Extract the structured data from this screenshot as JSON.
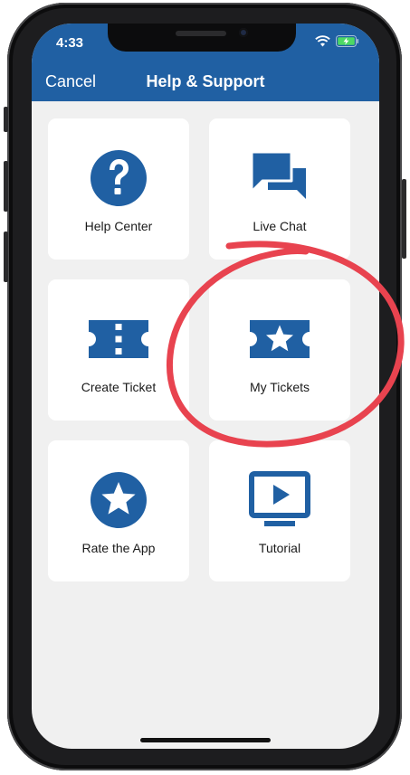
{
  "status_bar": {
    "time": "4:33"
  },
  "navbar": {
    "cancel_label": "Cancel",
    "title": "Help & Support"
  },
  "tiles": [
    {
      "label": "Help Center",
      "icon": "question-circle-icon"
    },
    {
      "label": "Live Chat",
      "icon": "chat-bubbles-icon"
    },
    {
      "label": "Create Ticket",
      "icon": "ticket-icon"
    },
    {
      "label": "My Tickets",
      "icon": "ticket-star-icon"
    },
    {
      "label": "Rate the App",
      "icon": "star-circle-icon"
    },
    {
      "label": "Tutorial",
      "icon": "play-screen-icon"
    }
  ],
  "colors": {
    "brand_blue": "#2060a3",
    "background": "#f0f0f0",
    "annotation_red": "#e8434f"
  }
}
